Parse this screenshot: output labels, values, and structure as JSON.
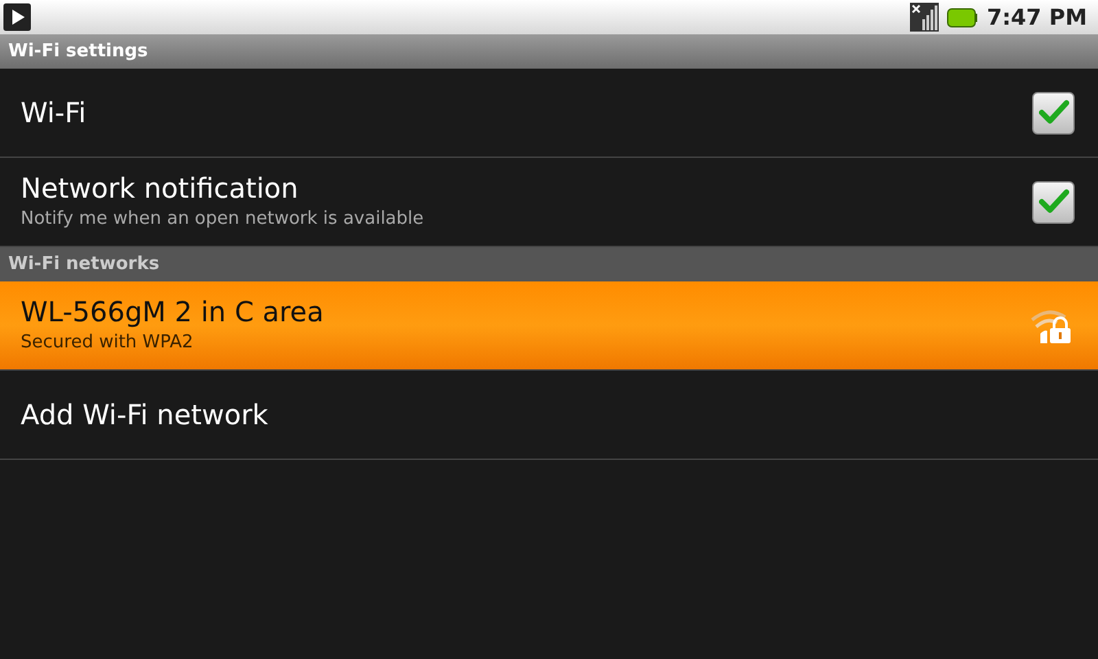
{
  "status_bar": {
    "time": "7:47 PM"
  },
  "title": "Wi-Fi settings",
  "settings": [
    {
      "label": "Wi-Fi",
      "checked": true
    },
    {
      "label": "Network notification",
      "summary": "Notify me when an open network is available",
      "checked": true
    }
  ],
  "networks_header": "Wi-Fi networks",
  "networks": [
    {
      "name": "WL-566gM 2 in C area",
      "summary": "Secured with WPA2",
      "selected": true
    }
  ],
  "add_network": "Add Wi-Fi network"
}
